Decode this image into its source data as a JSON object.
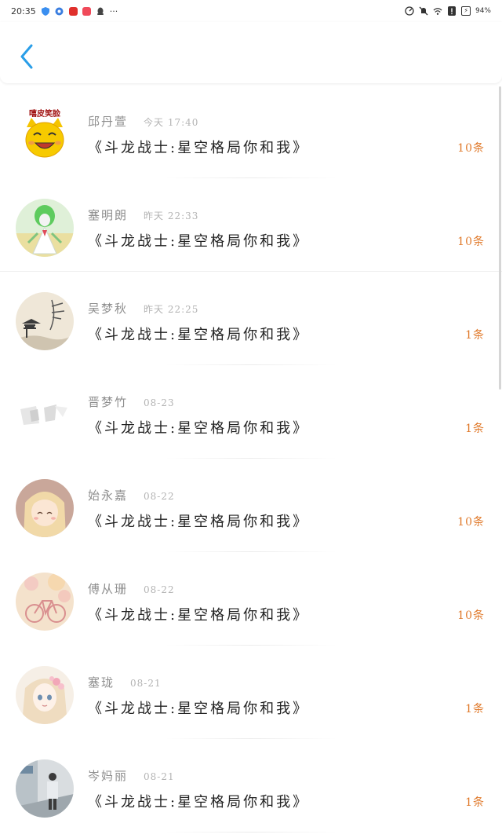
{
  "status_bar": {
    "time": "20:35",
    "battery": "94%",
    "more_dots": "···"
  },
  "header": {
    "back_icon": "chevron-left-icon",
    "accent_color": "#2a9ee8"
  },
  "list": {
    "items": [
      {
        "name": "邱丹萱",
        "time": "今天 17:40",
        "title": "《斗龙战士:星空格局你和我》",
        "count": "10条",
        "avatar_text": "嘻皮笑脸",
        "avatar": "smiley-cat-avatar"
      },
      {
        "name": "塞明朗",
        "time": "昨天 22:33",
        "title": "《斗龙战士:星空格局你和我》",
        "count": "10条",
        "avatar": "gardevoir-avatar"
      },
      {
        "name": "吴梦秋",
        "time": "昨天 22:25",
        "title": "《斗龙战士:星空格局你和我》",
        "count": "1条",
        "avatar": "ink-painting-avatar"
      },
      {
        "name": "晋梦竹",
        "time": "08-23",
        "title": "《斗龙战士:星空格局你和我》",
        "count": "1条",
        "avatar": "gray-sketch-avatar"
      },
      {
        "name": "始永嘉",
        "time": "08-22",
        "title": "《斗龙战士:星空格局你和我》",
        "count": "10条",
        "avatar": "anime-girl-avatar"
      },
      {
        "name": "傅从珊",
        "time": "08-22",
        "title": "《斗龙战士:星空格局你和我》",
        "count": "10条",
        "avatar": "bicycle-flowers-avatar"
      },
      {
        "name": "塞珑",
        "time": "08-21",
        "title": "《斗龙战士:星空格局你和我》",
        "count": "1条",
        "avatar": "flower-girl-avatar"
      },
      {
        "name": "岑妈丽",
        "time": "08-21",
        "title": "《斗龙战士:星空格局你和我》",
        "count": "1条",
        "avatar": "street-photo-avatar"
      }
    ]
  },
  "colors": {
    "count": "#e07a2c",
    "name": "#8e8e8e",
    "time": "#b3b3b3",
    "title": "#222222"
  }
}
